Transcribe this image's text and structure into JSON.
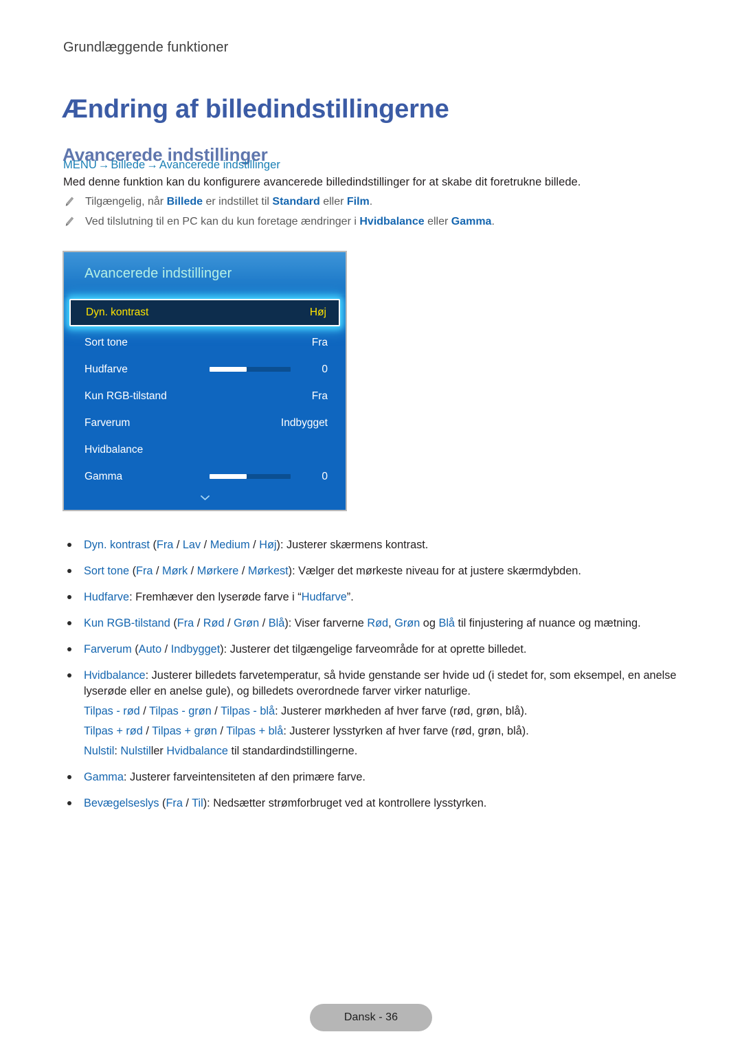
{
  "document": {
    "breadcrumb": "Grundlæggende funktioner",
    "page_title": "Ændring af billedindstillingerne",
    "section_title": "Avancerede indstillinger",
    "footer_label": "Dansk - 36"
  },
  "menu_path": {
    "root": "MENU",
    "arrow": "→",
    "level1": "Billede",
    "level2": "Avancerede indstillinger"
  },
  "intro": "Med denne funktion kan du konfigurere avancerede billedindstillinger for at skabe dit foretrukne billede.",
  "notes": [
    {
      "icon": "pencil-icon",
      "parts": [
        {
          "t": "Tilgængelig, når ",
          "style": "plain"
        },
        {
          "t": "Billede",
          "style": "link"
        },
        {
          "t": " er indstillet til ",
          "style": "plain"
        },
        {
          "t": "Standard",
          "style": "link"
        },
        {
          "t": " eller ",
          "style": "plain"
        },
        {
          "t": "Film",
          "style": "link"
        },
        {
          "t": ".",
          "style": "plain"
        }
      ],
      "plain": "Tilgængelig, når Billede er indstillet til Standard eller Film."
    },
    {
      "icon": "pencil-icon",
      "parts": [
        {
          "t": "Ved tilslutning til en PC kan du kun foretage ændringer i ",
          "style": "plain"
        },
        {
          "t": "Hvidbalance",
          "style": "link"
        },
        {
          "t": " eller ",
          "style": "plain"
        },
        {
          "t": "Gamma",
          "style": "link"
        },
        {
          "t": ".",
          "style": "plain"
        }
      ],
      "plain": "Ved tilslutning til en PC kan du kun foretage ændringer i Hvidbalance eller Gamma."
    }
  ],
  "tv_menu": {
    "title": "Avancerede indstillinger",
    "scroll_indicator_icon": "chevron-down-icon",
    "rows": [
      {
        "label": "Dyn. kontrast",
        "value": "Høj",
        "type": "value",
        "selected": true
      },
      {
        "label": "Sort tone",
        "value": "Fra",
        "type": "value",
        "selected": false
      },
      {
        "label": "Hudfarve",
        "value": "0",
        "type": "slider",
        "slider_percent": 46,
        "selected": false
      },
      {
        "label": "Kun RGB-tilstand",
        "value": "Fra",
        "type": "value",
        "selected": false
      },
      {
        "label": "Farverum",
        "value": "Indbygget",
        "type": "value",
        "selected": false
      },
      {
        "label": "Hvidbalance",
        "value": "",
        "type": "value",
        "selected": false
      },
      {
        "label": "Gamma",
        "value": "0",
        "type": "slider",
        "slider_percent": 46,
        "selected": false
      }
    ]
  },
  "bullets": [
    {
      "id": "dyn-kontrast",
      "text": "Dyn. kontrast (Fra / Lav / Medium / Høj): Justerer skærmens kontrast."
    },
    {
      "id": "sort-tone",
      "text": "Sort tone (Fra / Mørk / Mørkere / Mørkest): Vælger det mørkeste niveau for at justere skærmdybden."
    },
    {
      "id": "hudfarve",
      "text": "Hudfarve: Fremhæver den lyserøde farve i “Hudfarve”."
    },
    {
      "id": "kun-rgb-tilstand",
      "text": "Kun RGB-tilstand (Fra / Rød / Grøn / Blå): Viser farverne Rød, Grøn og Blå til finjustering af nuance og mætning."
    },
    {
      "id": "farverum",
      "text": "Farverum (Auto / Indbygget): Justerer det tilgængelige farveområde for at oprette billedet."
    },
    {
      "id": "hvidbalance",
      "text": "Hvidbalance: Justerer billedets farvetemperatur, så hvide genstande ser hvide ud (i stedet for, som eksempel, en anelse lyserøde eller en anelse gule), og billedets overordnede farver virker naturlige.",
      "sublines": [
        "Tilpas - rød / Tilpas - grøn / Tilpas - blå: Justerer mørkheden af hver farve (rød, grøn, blå).",
        "Tilpas + rød / Tilpas + grøn / Tilpas + blå: Justerer lysstyrken af hver farve (rød, grøn, blå).",
        "Nulstil: Nulstiller Hvidbalance til standardindstillingerne."
      ]
    },
    {
      "id": "gamma",
      "text": "Gamma: Justerer farveintensiteten af den primære farve."
    },
    {
      "id": "bevaegelseslys",
      "text": "Bevægelseslys (Fra / Til): Nedsætter strømforbruget ved at kontrollere lysstyrken."
    }
  ],
  "colors": {
    "page_title": "#3b5ba5",
    "section_title": "#5f76ad",
    "link": "#1566b0",
    "menu_path": "#1a7fb5",
    "tv_panel": "#0f66bf",
    "tv_title": "#b5f0e6",
    "tv_highlight_text": "#ffe400",
    "tv_highlight_bg": "#0d2d4d",
    "tv_glow": "#44d4ff",
    "footer_pill": "#b6b6b6"
  }
}
